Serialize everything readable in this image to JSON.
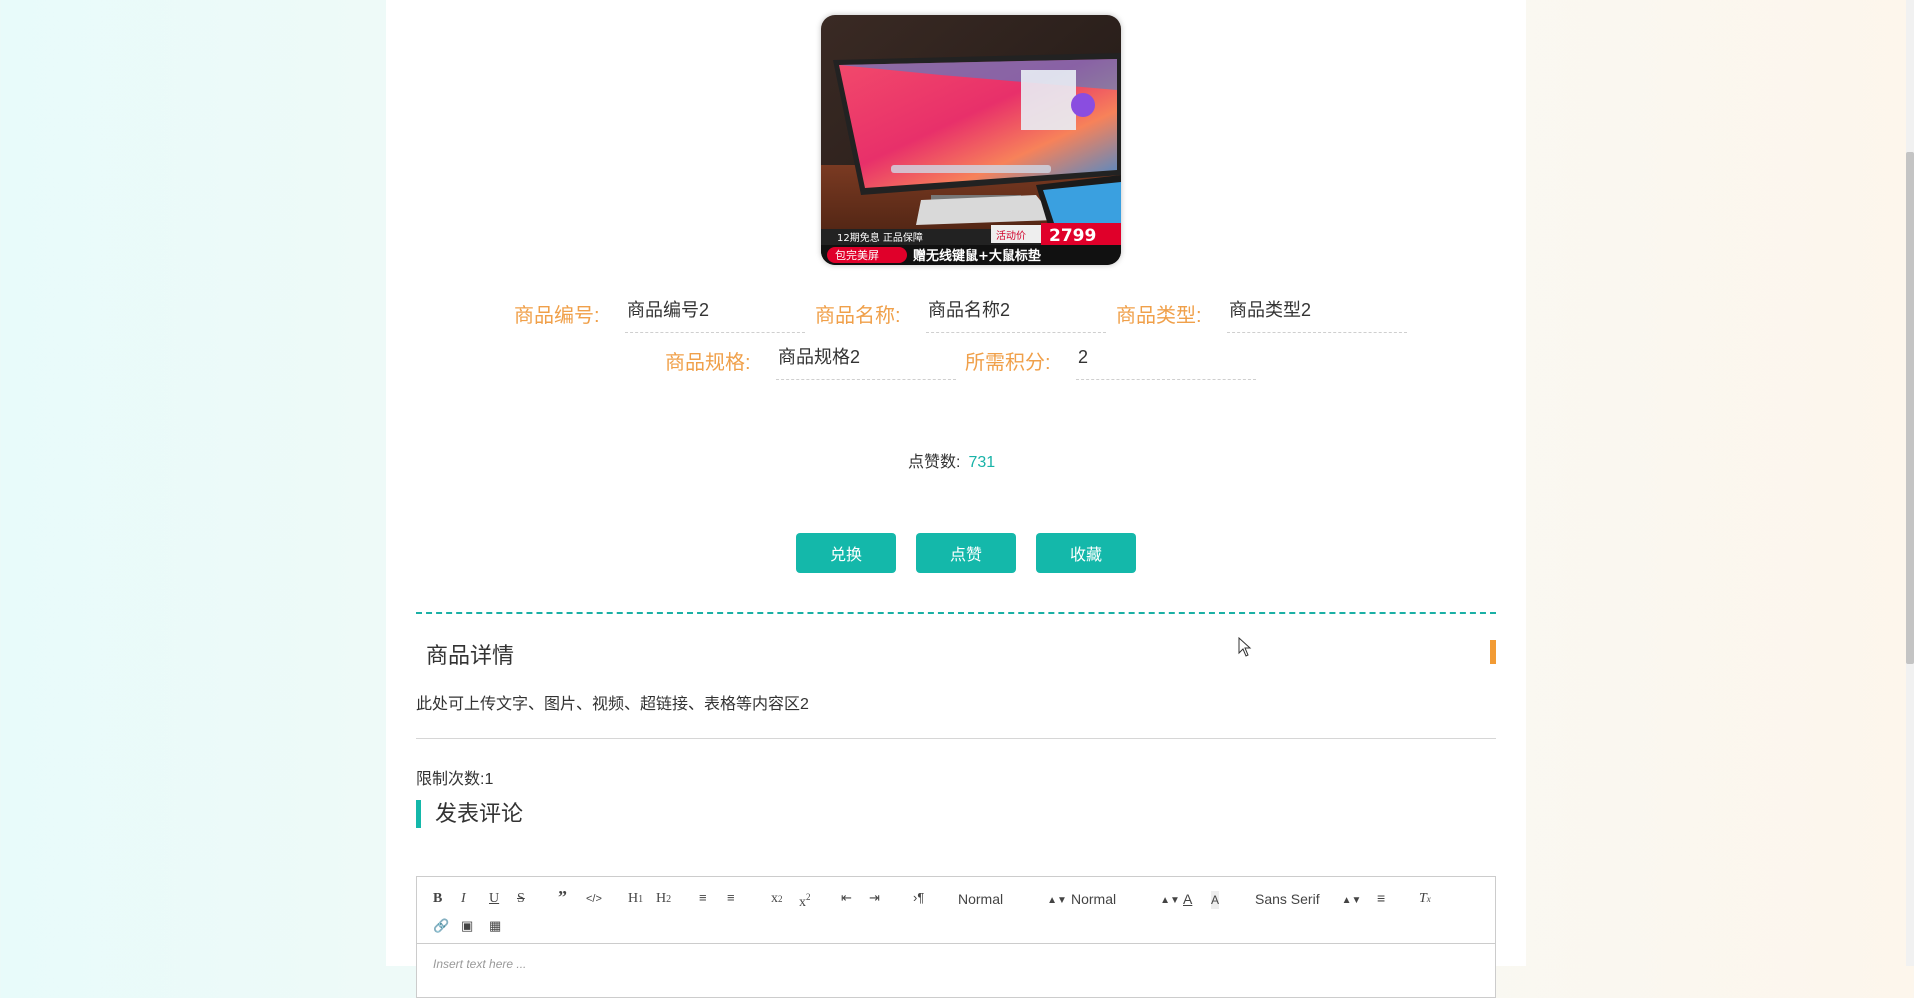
{
  "product": {
    "image_icon": "monitor-product-photo",
    "image_text": {
      "banner_top_left": "12期免息 正品保障",
      "banner_tag": "活动价",
      "banner_price": "2799",
      "banner_badge": "包完美屏",
      "banner_bottom": "赠无线键鼠+大鼠标垫"
    },
    "fields": [
      {
        "label": "商品编号:",
        "value": "商品编号2"
      },
      {
        "label": "商品名称:",
        "value": "商品名称2"
      },
      {
        "label": "商品类型:",
        "value": "商品类型2"
      },
      {
        "label": "商品规格:",
        "value": "商品规格2"
      },
      {
        "label": "所需积分:",
        "value": "2"
      }
    ],
    "likes_label": "点赞数:",
    "likes_count": "731"
  },
  "actions": {
    "exchange": "兑换",
    "like": "点赞",
    "favorite": "收藏"
  },
  "detail": {
    "title": "商品详情",
    "content": "此处可上传文字、图片、视频、超链接、表格等内容区2"
  },
  "limit": {
    "label": "限制次数:",
    "value": "1"
  },
  "comment": {
    "title": "发表评论",
    "editor": {
      "header_select": "Normal",
      "size_select": "Normal",
      "font_select": "Sans Serif",
      "placeholder": "Insert text here ..."
    }
  },
  "colors": {
    "accent": "#14b8aa",
    "label": "#f0a04a",
    "marker": "#f29b34"
  }
}
